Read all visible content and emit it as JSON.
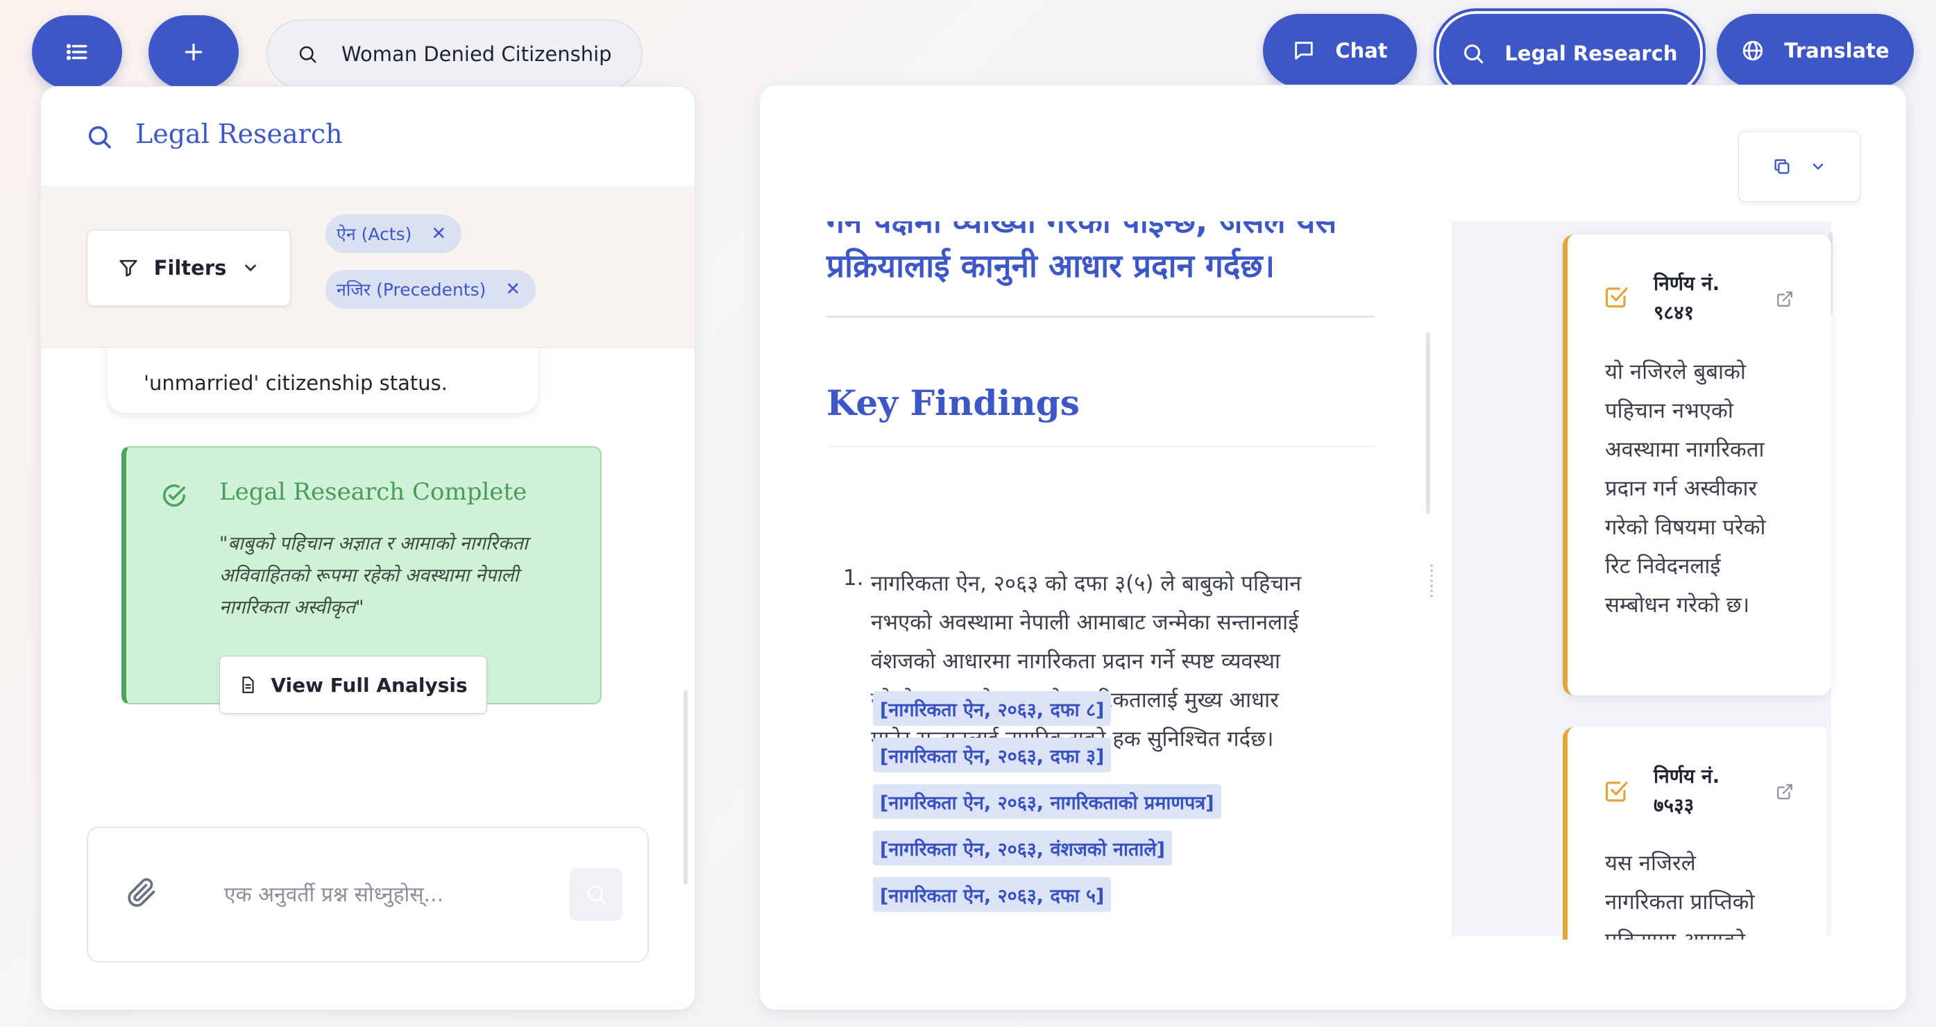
{
  "topbar": {
    "search_value": "Woman Denied Citizenship",
    "chat_label": "Chat",
    "research_label": "Legal Research",
    "translate_label": "Translate"
  },
  "left_panel": {
    "title": "Legal Research",
    "filters_label": "Filters",
    "chips": [
      "ऐन (Acts)",
      "नजिर (Precedents)"
    ],
    "prev_message_tail": "'unmarried' citizenship status.",
    "complete_card": {
      "title": "Legal Research Complete",
      "quote": "\"बाबुको पहिचान अज्ञात र आमाको नागरिकता अविवाहितको रूपमा रहेको अवस्थामा नेपाली नागरिकता अस्वीकृत\"",
      "button_label": "View Full Analysis"
    },
    "followup_placeholder": "एक अनुवर्ती प्रश्न सोध्नुहोस्..."
  },
  "document": {
    "intro_cut": "गन पक्षमा व्याख्या गरेको पाइन्छ, जसले यस",
    "intro_line2": "प्रक्रियालाई कानुनी आधार प्रदान गर्दछ।",
    "section_title": "Key Findings",
    "finding_number": "1.",
    "finding_lines": [
      "नागरिकता ऐन, २०६३ को दफा ३(५) ले बाबुको पहिचान",
      "नभएको अवस्थामा नेपाली आमाबाट जन्मेका सन्तानलाई",
      "वंशजको आधारमा नागरिकता प्रदान गर्ने स्पष्ट व्यवस्था",
      "गरेको छ। यसले आमाको नागरिकतालाई मुख्य आधार",
      "मानेर सन्तानलाई नागरिकताको हक सुनिश्चित गर्दछ।"
    ],
    "citations": [
      "[नागरिकता ऐन, २०६३, दफा ८]",
      "[नागरिकता ऐन, २०६३, दफा ३]",
      "[नागरिकता ऐन, २०६३, नागरिकताको प्रमाणपत्र]",
      "[नागरिकता ऐन, २०६३, वंशजको नाताले]",
      "[नागरिकता ऐन, २०६३, दफा ५]"
    ]
  },
  "rulings": [
    {
      "title_line1": "निर्णय नं.",
      "title_line2": "९८४१",
      "body_lines": [
        "यो नजिरले बुबाको",
        "पहिचान नभएको",
        "अवस्थामा नागरिकता",
        "प्रदान गर्न अस्वीकार",
        "गरेको विषयमा परेको",
        "रिट निवेदनलाई",
        "सम्बोधन गरेको छ।"
      ]
    },
    {
      "title_line1": "निर्णय नं.",
      "title_line2": "७५३३",
      "body_lines": [
        "यस नजिरले",
        "नागरिकता प्राप्तिको",
        "प्रक्रियामा आमाको"
      ]
    }
  ],
  "colors": {
    "primary": "#3d57c6",
    "success_bg": "#cff2d6",
    "success_border": "#4aa35f",
    "gold": "#e0a83a"
  }
}
